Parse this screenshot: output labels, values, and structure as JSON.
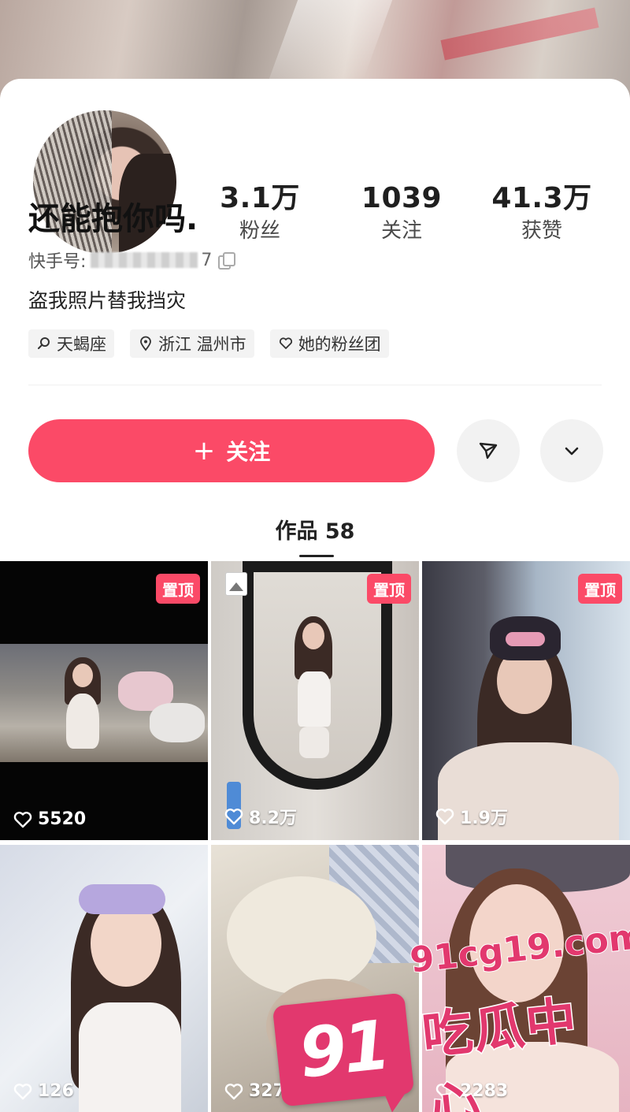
{
  "profile": {
    "stats": [
      {
        "value": "3.1万",
        "label": "粉丝"
      },
      {
        "value": "1039",
        "label": "关注"
      },
      {
        "value": "41.3万",
        "label": "获赞"
      }
    ],
    "nickname": "还能抱你吗.",
    "uid_label": "快手号:",
    "uid_suffix": "7",
    "bio": "盗我照片替我挡灾",
    "tags": [
      {
        "icon": "search-icon",
        "text": "天蝎座"
      },
      {
        "icon": "location-pin-icon",
        "text": "浙江 温州市"
      },
      {
        "icon": "heart-outline-icon",
        "text": "她的粉丝团"
      }
    ]
  },
  "actions": {
    "follow_plus": "+",
    "follow_label": "关注",
    "share_icon": "send-icon",
    "more_icon": "chevron-down-icon"
  },
  "works_tab": {
    "label": "作品 58"
  },
  "works": [
    {
      "likes": "5520",
      "pinned": true,
      "pin_label": "置顶",
      "image_post": false
    },
    {
      "likes": "8.2万",
      "pinned": true,
      "pin_label": "置顶",
      "image_post": true
    },
    {
      "likes": "1.9万",
      "pinned": true,
      "pin_label": "置顶",
      "image_post": false
    },
    {
      "likes": "126",
      "pinned": false,
      "image_post": false
    },
    {
      "likes": "327",
      "pinned": false,
      "image_post": false
    },
    {
      "likes": "2283",
      "pinned": false,
      "image_post": false
    }
  ],
  "watermark": {
    "logo_number": "91",
    "url": "91cg19.com",
    "name": "吃瓜中心"
  },
  "colors": {
    "accent": "#fb4a67",
    "watermark": "#e2386e"
  }
}
